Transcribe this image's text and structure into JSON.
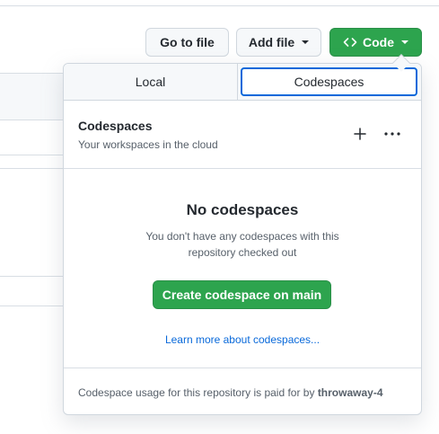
{
  "toolbar": {
    "go_to_file": "Go to file",
    "add_file": "Add file",
    "code": "Code"
  },
  "dropdown": {
    "tabs": [
      {
        "label": "Local",
        "active": false
      },
      {
        "label": "Codespaces",
        "active": true
      }
    ],
    "codespaces": {
      "title": "Codespaces",
      "subtitle": "Your workspaces in the cloud",
      "empty_title": "No codespaces",
      "empty_desc": "You don't have any codespaces with this repository checked out",
      "create_button": "Create codespace on main",
      "learn_more": "Learn more about codespaces...",
      "footer_text": "Codespace usage for this repository is paid for by ",
      "footer_owner": "throwaway-4"
    }
  },
  "colors": {
    "primary_green": "#2da44e",
    "link_blue": "#0969da",
    "border": "#d0d7de",
    "muted_text": "#57606a"
  },
  "icons": {
    "code": "code-icon",
    "plus": "plus-icon",
    "kebab": "kebab-horizontal-icon"
  }
}
